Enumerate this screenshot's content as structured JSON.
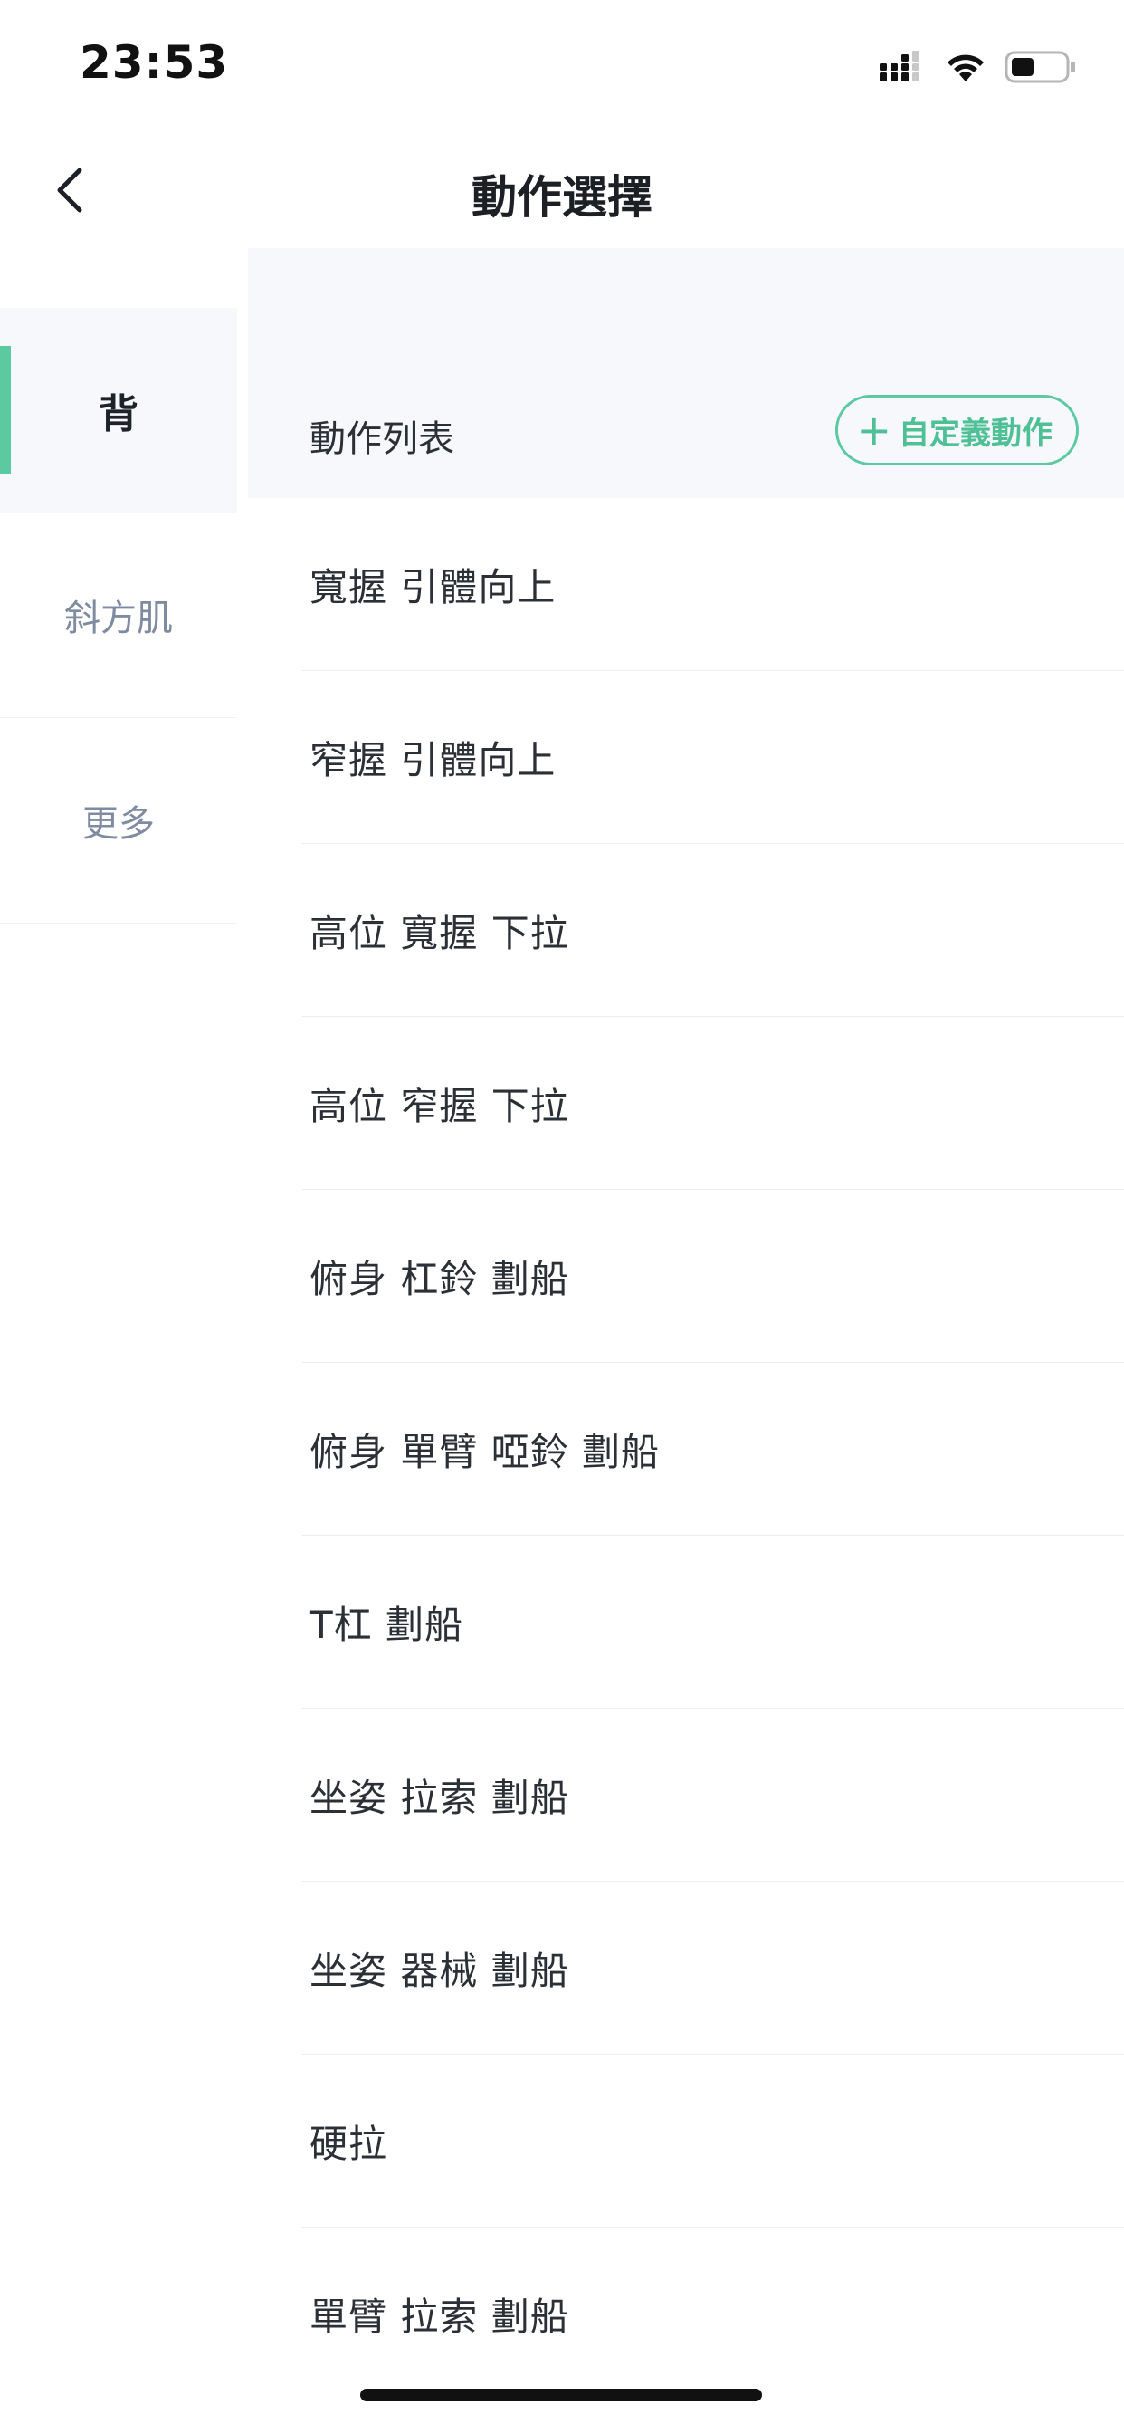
{
  "status_bar": {
    "time": "23:53"
  },
  "nav": {
    "title": "動作選擇"
  },
  "sidebar": {
    "items": [
      {
        "label": "背",
        "active": true
      },
      {
        "label": "斜方肌",
        "active": false
      },
      {
        "label": "更多",
        "active": false
      }
    ]
  },
  "list": {
    "header_title": "動作列表",
    "custom_button_label": "自定義動作",
    "items": [
      "寬握 引體向上",
      "窄握 引體向上",
      "高位 寬握 下拉",
      "高位 窄握 下拉",
      "俯身 杠鈴 劃船",
      "俯身 單臂 啞鈴 劃船",
      "T杠 劃船",
      "坐姿 拉索 劃船",
      "坐姿 器械 劃船",
      "硬拉",
      "單臂 拉索 劃船"
    ]
  },
  "colors": {
    "accent": "#5cc9a0",
    "sidebar_active_bg": "#f6f8fc",
    "inactive_text": "#7f8ba0"
  },
  "icons": {
    "back": "chevron-left-icon",
    "signal": "signal-icon",
    "wifi": "wifi-icon",
    "battery": "battery-icon",
    "plus": "plus-icon"
  }
}
